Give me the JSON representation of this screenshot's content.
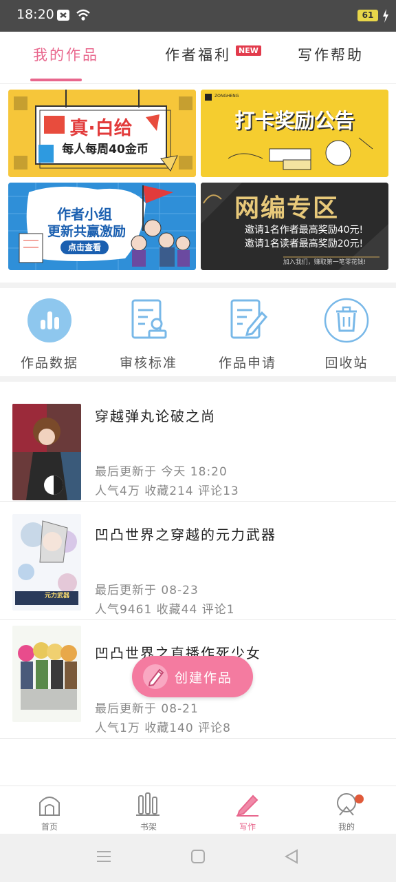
{
  "status_bar": {
    "time": "18:20",
    "battery": "61"
  },
  "tabs": [
    {
      "label": "我的作品",
      "active": true
    },
    {
      "label": "作者福利",
      "badge": "NEW"
    },
    {
      "label": "写作帮助"
    }
  ],
  "banners": [
    {
      "line1": "真·白给",
      "line2": "每人每周40金币"
    },
    {
      "line1": "打卡奖励公告",
      "brand": "ZONGHENG"
    },
    {
      "line1": "作者小组",
      "line2": "更新共赢激励",
      "button": "点击查看"
    },
    {
      "line1": "网编专区",
      "line2": "邀请1名作者最高奖励40元!",
      "line3": "邀请1名读者最高奖励20元!",
      "line4": "加入我们，赚取第一笔零花钱!"
    }
  ],
  "actions": [
    {
      "label": "作品数据",
      "icon": "bar-chart-icon"
    },
    {
      "label": "审核标准",
      "icon": "document-stamp-icon"
    },
    {
      "label": "作品申请",
      "icon": "edit-document-icon"
    },
    {
      "label": "回收站",
      "icon": "trash-icon"
    }
  ],
  "works": [
    {
      "title": "穿越弹丸论破之尚",
      "updated": "最后更新于 今天 18:20",
      "stats": "人气4万 收藏214 评论13"
    },
    {
      "title": "凹凸世界之穿越的元力武器",
      "updated": "最后更新于 08-23",
      "stats": "人气9461 收藏44 评论1",
      "cover_text": "元力武器"
    },
    {
      "title": "凹凸世界之直播作死少女",
      "updated": "最后更新于 08-21",
      "stats": "人气1万 收藏140 评论8"
    }
  ],
  "fab": {
    "label": "创建作品"
  },
  "bottom_nav": [
    {
      "label": "首页"
    },
    {
      "label": "书架"
    },
    {
      "label": "写作",
      "active": true
    },
    {
      "label": "我的",
      "has_dot": true
    }
  ],
  "colors": {
    "accent": "#e8678d",
    "fab": "#f47ba0",
    "icon_blue": "#78b8e8"
  }
}
